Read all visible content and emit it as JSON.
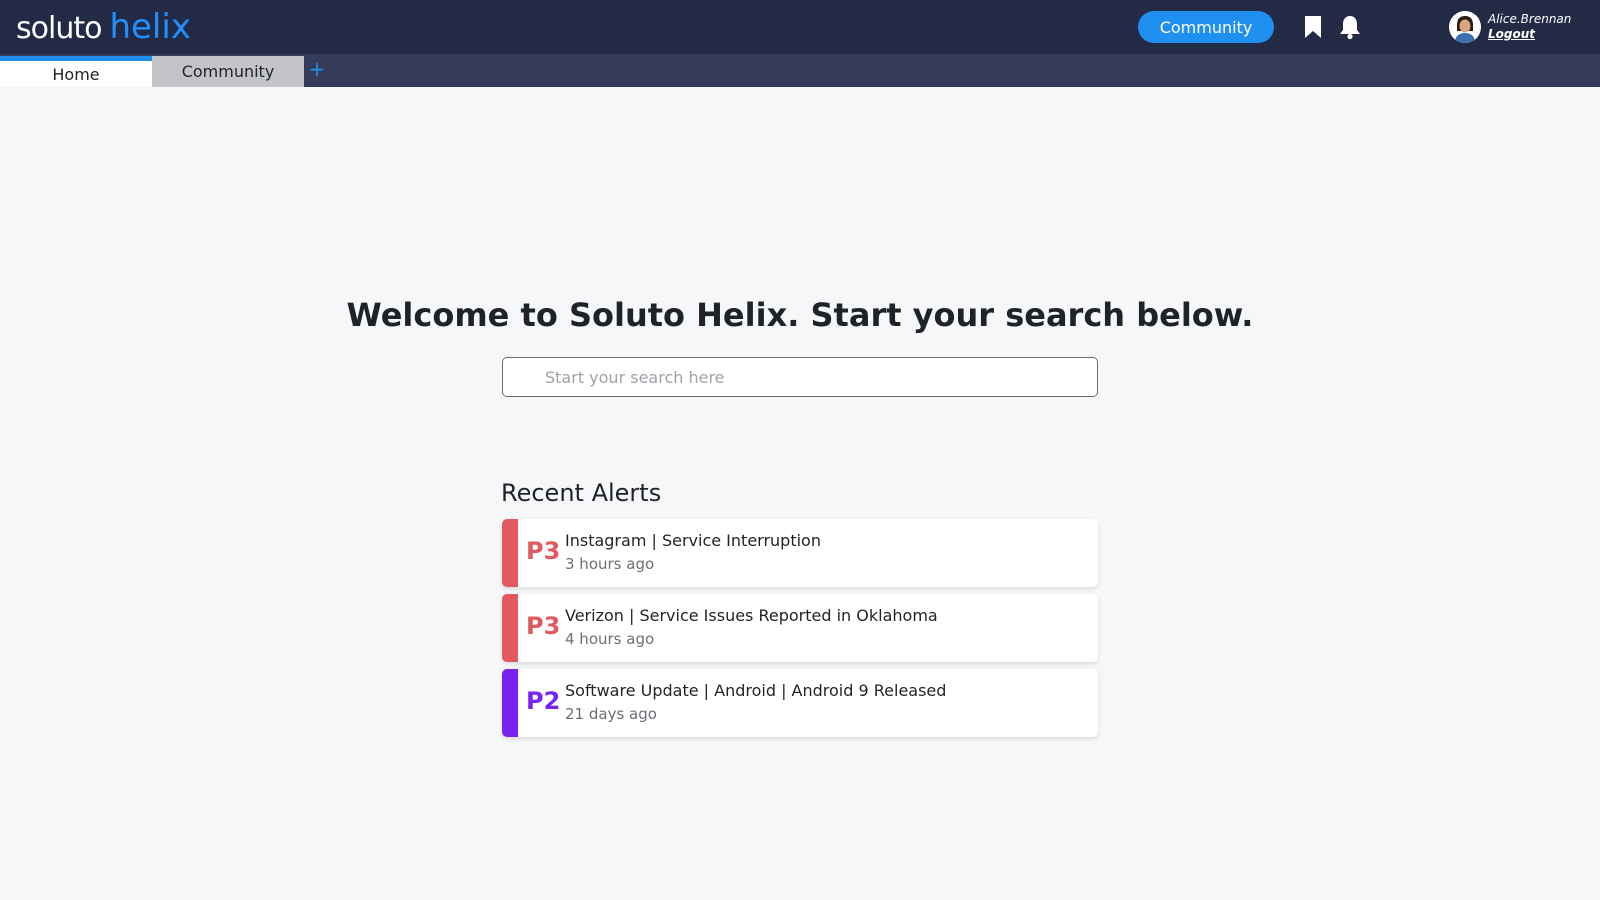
{
  "header": {
    "logo_part1": "soluto",
    "logo_part2": "helix",
    "community_button": "Community",
    "bookmark_icon": "bookmark-icon",
    "bell_icon": "bell-icon",
    "username": "Alice.Brennan",
    "logout": "Logout"
  },
  "tabs": [
    {
      "label": "Home",
      "active": true
    },
    {
      "label": "Community",
      "active": false
    }
  ],
  "tab_add": "+",
  "main": {
    "welcome": "Welcome to Soluto Helix. Start your search below.",
    "search_placeholder": "Start your search here",
    "alerts_title": "Recent Alerts",
    "alerts": [
      {
        "priority": "P3",
        "title": "Instagram | Service Interruption",
        "time": "3 hours ago",
        "color": "#e05a5f"
      },
      {
        "priority": "P3",
        "title": "Verizon | Service Issues Reported in Oklahoma",
        "time": "4 hours ago",
        "color": "#e05a5f"
      },
      {
        "priority": "P2",
        "title": "Software Update | Android | Android 9 Released",
        "time": "21 days ago",
        "color": "#7a22f0"
      }
    ]
  },
  "colors": {
    "topbar": "#232a45",
    "tabbar": "#353b5a",
    "accent": "#1f8ff0",
    "p3": "#e05a5f",
    "p2": "#7a22f0"
  }
}
